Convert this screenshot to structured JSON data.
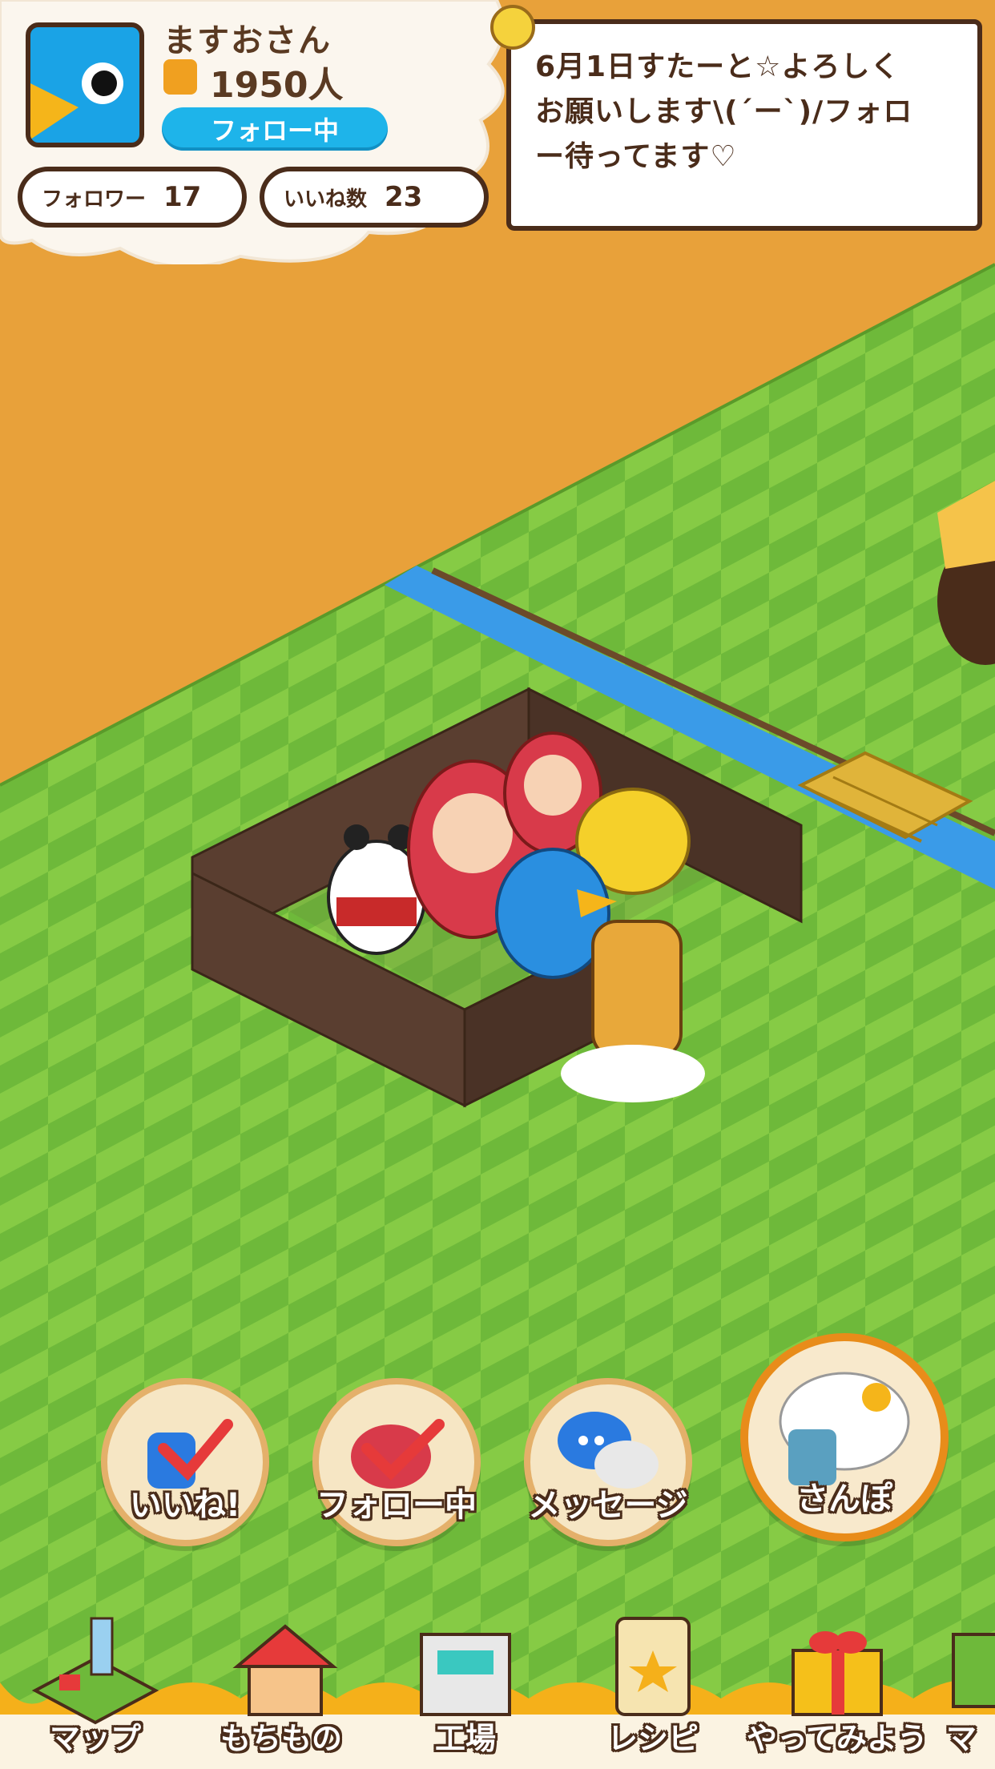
{
  "profile": {
    "name": "ますおさん",
    "followers_total": "1950人",
    "follow_status": "フォロー中",
    "stats": [
      {
        "label": "フォロワー",
        "value": "17"
      },
      {
        "label": "いいね数",
        "value": "23"
      }
    ]
  },
  "message_bubble": {
    "text": "6月1日すたーと☆よろしく\nお願いします\\(´ー`)/フォロ\nー待ってます♡"
  },
  "actions": [
    {
      "label": "いいね!",
      "icon": "thumbs-up-check-icon"
    },
    {
      "label": "フォロー中",
      "icon": "follow-check-icon"
    },
    {
      "label": "メッセージ",
      "icon": "chat-bubbles-icon"
    },
    {
      "label": "さんぽ",
      "icon": "sheep-walk-icon"
    }
  ],
  "nav": [
    {
      "label": "マップ",
      "icon": "map-icon"
    },
    {
      "label": "もちもの",
      "icon": "house-icon"
    },
    {
      "label": "工場",
      "icon": "factory-icon"
    },
    {
      "label": "レシピ",
      "icon": "recipe-book-icon"
    },
    {
      "label": "やってみよう",
      "icon": "gift-box-icon"
    },
    {
      "label": "マ",
      "icon": "partial-nav-icon"
    }
  ],
  "colors": {
    "background": "#e8a13a",
    "grass_light": "#8fd14f",
    "grass_dark": "#6db83b",
    "river": "#3a9be8",
    "outline": "#4a2c1a",
    "follow_blue": "#1eb4ea"
  }
}
